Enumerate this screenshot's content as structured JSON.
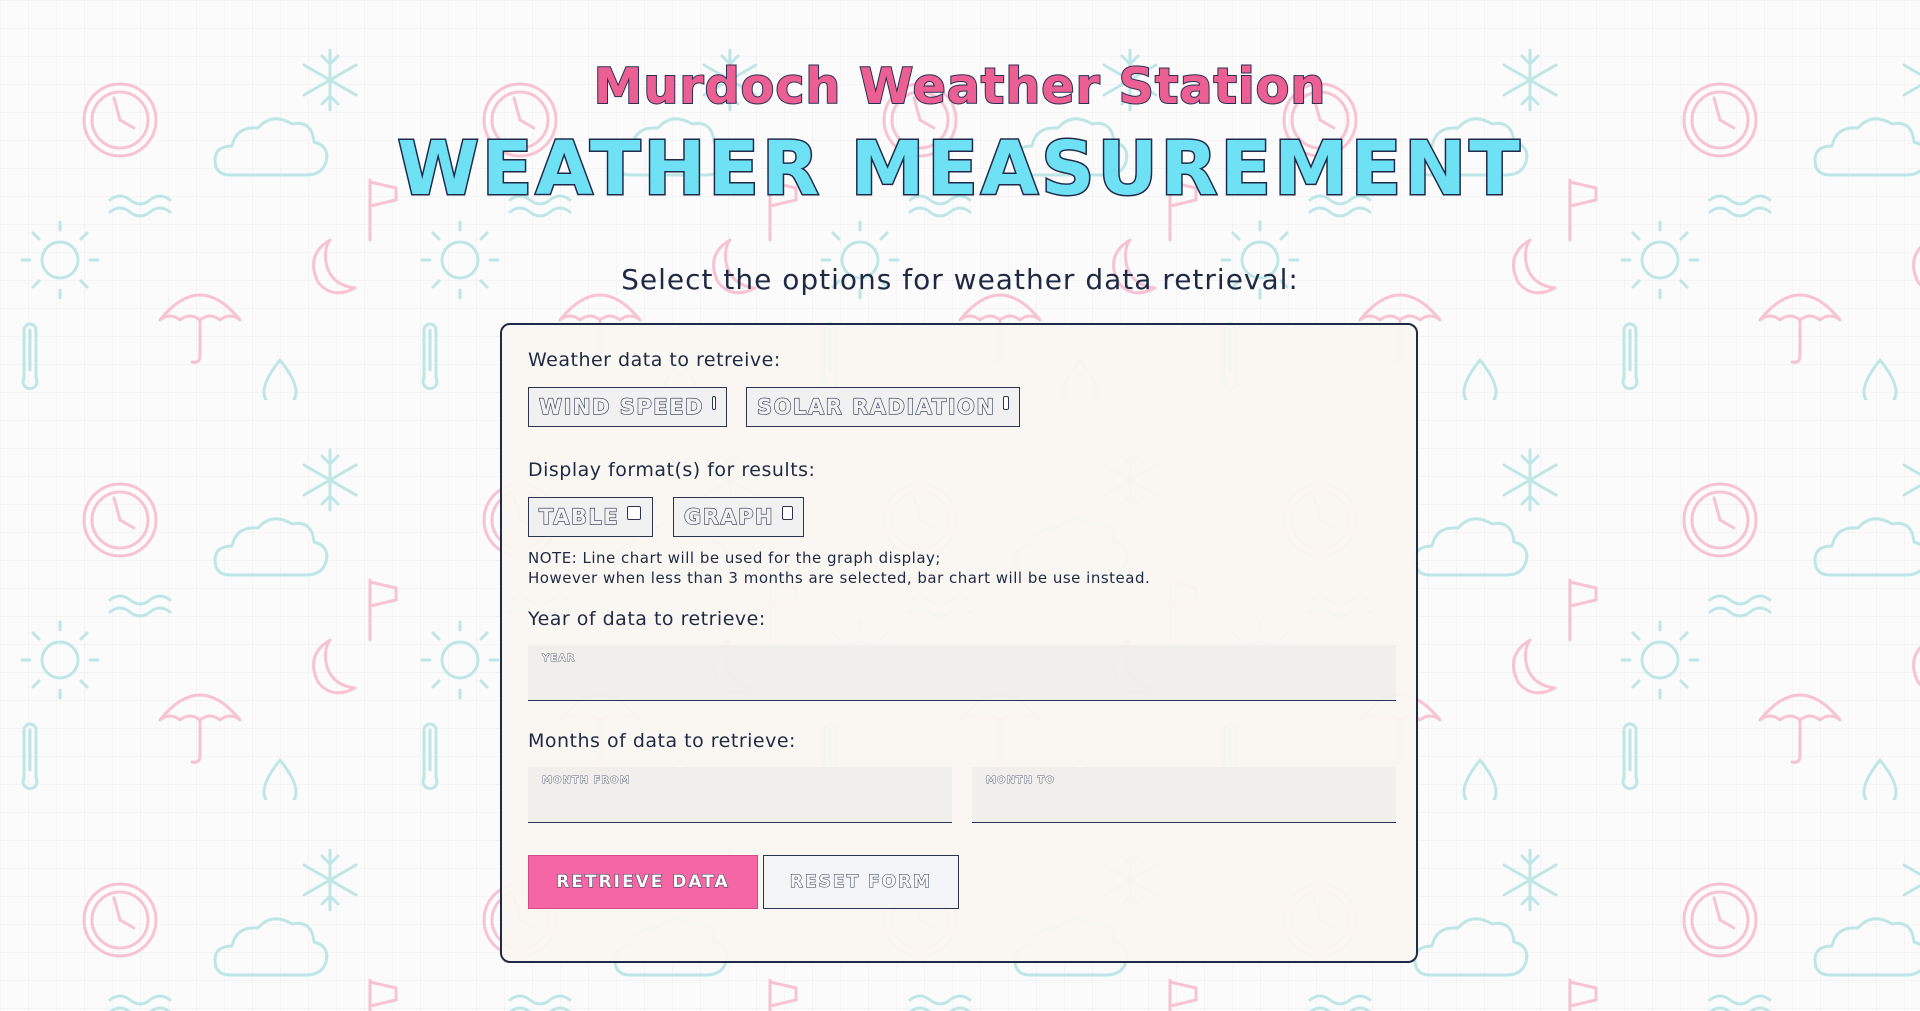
{
  "header": {
    "station_title": "Murdoch Weather Station",
    "main_title": "WEATHER MEASUREMENT",
    "subtitle": "Select the options for weather data retrieval:"
  },
  "form": {
    "data_section": {
      "label": "Weather data to retreive:",
      "options": [
        {
          "label": "WIND SPEED",
          "checked": false
        },
        {
          "label": "SOLAR RADIATION",
          "checked": false
        }
      ]
    },
    "display_section": {
      "label": "Display format(s) for results:",
      "options": [
        {
          "label": "TABLE",
          "checked": false
        },
        {
          "label": "GRAPH",
          "checked": false
        }
      ],
      "note_line1": "NOTE: Line chart will be used for the graph display;",
      "note_line2": "However when less than 3 months are selected, bar chart will be use instead."
    },
    "year_section": {
      "label": "Year of data to retrieve:",
      "field_label": "YEAR",
      "value": ""
    },
    "months_section": {
      "label": "Months of data to retrieve:",
      "from_label": "MONTH FROM",
      "from_value": "",
      "to_label": "MONTH TO",
      "to_value": ""
    },
    "buttons": {
      "retrieve": "RETRIEVE DATA",
      "reset": "RESET FORM"
    }
  },
  "colors": {
    "pink_accent": "#ec5f93",
    "cyan_accent": "#6fe1f4",
    "navy": "#1f2a4a",
    "button_pink": "#f466a4"
  }
}
